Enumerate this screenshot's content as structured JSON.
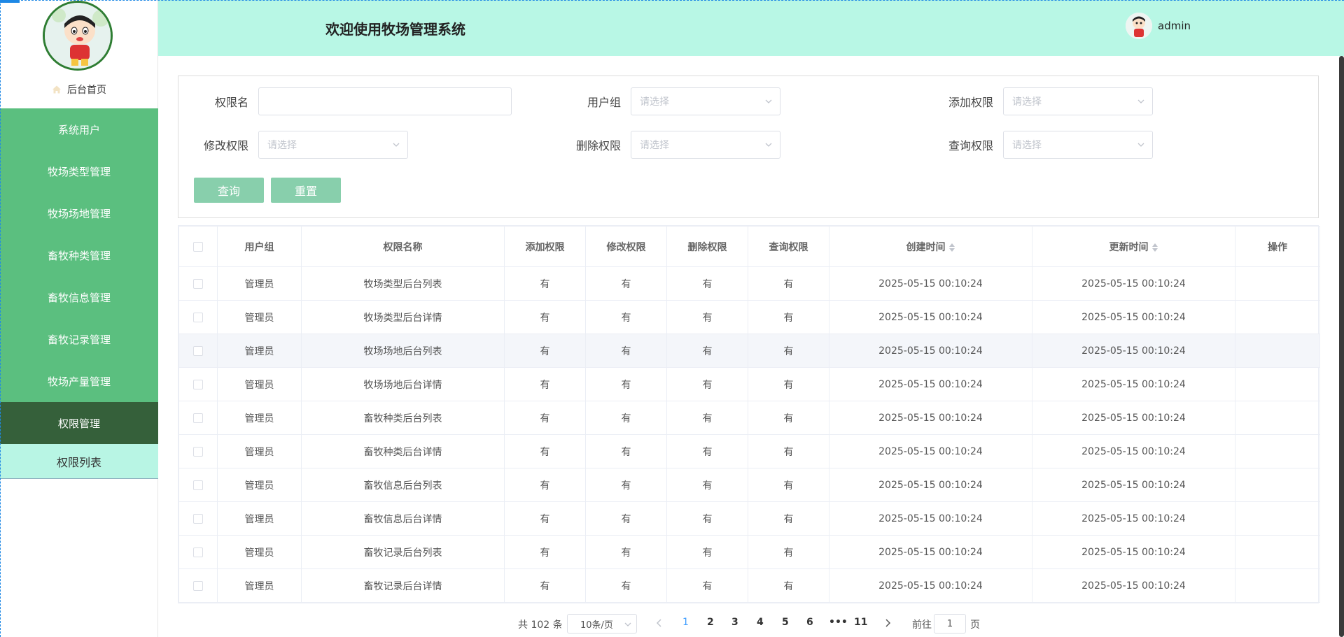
{
  "header": {
    "title": "欢迎使用牧场管理系统",
    "username": "admin"
  },
  "sidebar": {
    "home_label": "后台首页",
    "menu": [
      {
        "label": "系统用户"
      },
      {
        "label": "牧场类型管理"
      },
      {
        "label": "牧场场地管理"
      },
      {
        "label": "畜牧种类管理"
      },
      {
        "label": "畜牧信息管理"
      },
      {
        "label": "畜牧记录管理"
      },
      {
        "label": "牧场产量管理"
      },
      {
        "label": "权限管理"
      }
    ],
    "submenu_label": "权限列表"
  },
  "search": {
    "name_label": "权限名",
    "name_value": "",
    "group_label": "用户组",
    "group_placeholder": "请选择",
    "add_label": "添加权限",
    "add_placeholder": "请选择",
    "edit_label": "修改权限",
    "edit_placeholder": "请选择",
    "delete_label": "删除权限",
    "delete_placeholder": "请选择",
    "query_label": "查询权限",
    "query_placeholder": "请选择",
    "query_button": "查询",
    "reset_button": "重置"
  },
  "table": {
    "headers": [
      "用户组",
      "权限名称",
      "添加权限",
      "修改权限",
      "删除权限",
      "查询权限",
      "创建时间",
      "更新时间",
      "操作"
    ],
    "rows": [
      [
        "管理员",
        "牧场类型后台列表",
        "有",
        "有",
        "有",
        "有",
        "2025-05-15 00:10:24",
        "2025-05-15 00:10:24"
      ],
      [
        "管理员",
        "牧场类型后台详情",
        "有",
        "有",
        "有",
        "有",
        "2025-05-15 00:10:24",
        "2025-05-15 00:10:24"
      ],
      [
        "管理员",
        "牧场场地后台列表",
        "有",
        "有",
        "有",
        "有",
        "2025-05-15 00:10:24",
        "2025-05-15 00:10:24"
      ],
      [
        "管理员",
        "牧场场地后台详情",
        "有",
        "有",
        "有",
        "有",
        "2025-05-15 00:10:24",
        "2025-05-15 00:10:24"
      ],
      [
        "管理员",
        "畜牧种类后台列表",
        "有",
        "有",
        "有",
        "有",
        "2025-05-15 00:10:24",
        "2025-05-15 00:10:24"
      ],
      [
        "管理员",
        "畜牧种类后台详情",
        "有",
        "有",
        "有",
        "有",
        "2025-05-15 00:10:24",
        "2025-05-15 00:10:24"
      ],
      [
        "管理员",
        "畜牧信息后台列表",
        "有",
        "有",
        "有",
        "有",
        "2025-05-15 00:10:24",
        "2025-05-15 00:10:24"
      ],
      [
        "管理员",
        "畜牧信息后台详情",
        "有",
        "有",
        "有",
        "有",
        "2025-05-15 00:10:24",
        "2025-05-15 00:10:24"
      ],
      [
        "管理员",
        "畜牧记录后台列表",
        "有",
        "有",
        "有",
        "有",
        "2025-05-15 00:10:24",
        "2025-05-15 00:10:24"
      ],
      [
        "管理员",
        "畜牧记录后台详情",
        "有",
        "有",
        "有",
        "有",
        "2025-05-15 00:10:24",
        "2025-05-15 00:10:24"
      ]
    ]
  },
  "pagination": {
    "total": "共 102 条",
    "page_size": "10条/页",
    "pages": [
      "1",
      "2",
      "3",
      "4",
      "5",
      "6",
      "•••",
      "11"
    ],
    "current": "1",
    "goto_label": "前往",
    "goto_value": "1",
    "goto_suffix": "页"
  },
  "colors": {
    "header_bg": "#b8f7e5",
    "menu_bg": "#5bbf7f",
    "menu_active_bg": "#35603a",
    "submenu_bg": "#b8f5e4",
    "button_bg": "#88cfac",
    "current_page": "#409eff"
  }
}
